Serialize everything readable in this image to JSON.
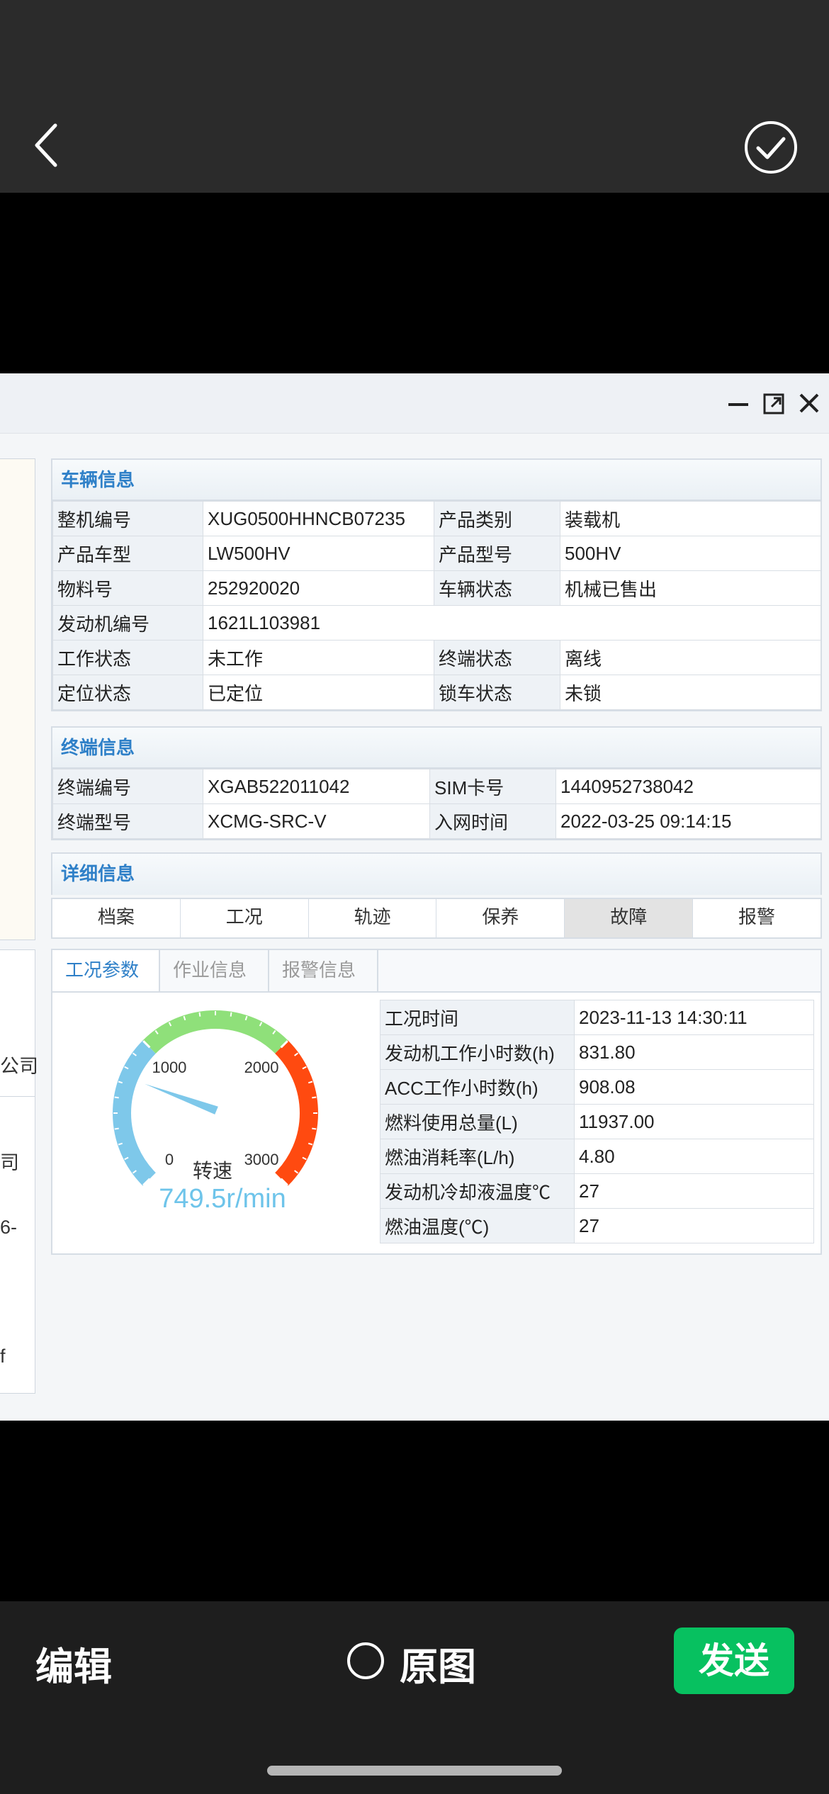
{
  "viewer": {
    "edit_label": "编辑",
    "original_label": "原图",
    "send_label": "发送"
  },
  "vehicle_info": {
    "title": "车辆信息",
    "rows": [
      [
        "整机编号",
        "XUG0500HHNCB07235",
        "产品类别",
        "装载机"
      ],
      [
        "产品车型",
        "LW500HV",
        "产品型号",
        "500HV"
      ],
      [
        "物料号",
        "252920020",
        "车辆状态",
        "机械已售出"
      ],
      [
        "发动机编号",
        "1621L103981",
        "",
        ""
      ],
      [
        "工作状态",
        "未工作",
        "终端状态",
        "离线"
      ],
      [
        "定位状态",
        "已定位",
        "锁车状态",
        "未锁"
      ]
    ]
  },
  "terminal_info": {
    "title": "终端信息",
    "rows": [
      [
        "终端编号",
        "XGAB522011042",
        "SIM卡号",
        "1440952738042"
      ],
      [
        "终端型号",
        "XCMG-SRC-V",
        "入网时间",
        "2022-03-25 09:14:15"
      ]
    ]
  },
  "detail_info": {
    "title": "详细信息",
    "tabs": [
      "档案",
      "工况",
      "轨迹",
      "保养",
      "故障",
      "报警"
    ],
    "active_tab": "故障"
  },
  "sub_tabs": [
    "工况参数",
    "作业信息",
    "报警信息"
  ],
  "gauge": {
    "label": "转速",
    "value_text": "749.5r/min",
    "value": 749.5,
    "min": 0,
    "max": 3000,
    "tick_labels": [
      "0",
      "1000",
      "2000",
      "3000"
    ],
    "colors": {
      "low": "#7ec8ea",
      "mid": "#8fe07a",
      "high": "#ff4a10",
      "needle": "#7ec8ea"
    }
  },
  "work_params": [
    [
      "工况时间",
      "2023-11-13 14:30:11"
    ],
    [
      "发动机工作小时数(h)",
      "831.80"
    ],
    [
      "ACC工作小时数(h)",
      "908.08"
    ],
    [
      "燃料使用总量(L)",
      "11937.00"
    ],
    [
      "燃油消耗率(L/h)",
      "4.80"
    ],
    [
      "发动机冷却液温度℃",
      "27"
    ],
    [
      "燃油温度(℃)",
      "27"
    ]
  ],
  "left_fragments": [
    "公司",
    "司",
    "6-",
    "f"
  ]
}
